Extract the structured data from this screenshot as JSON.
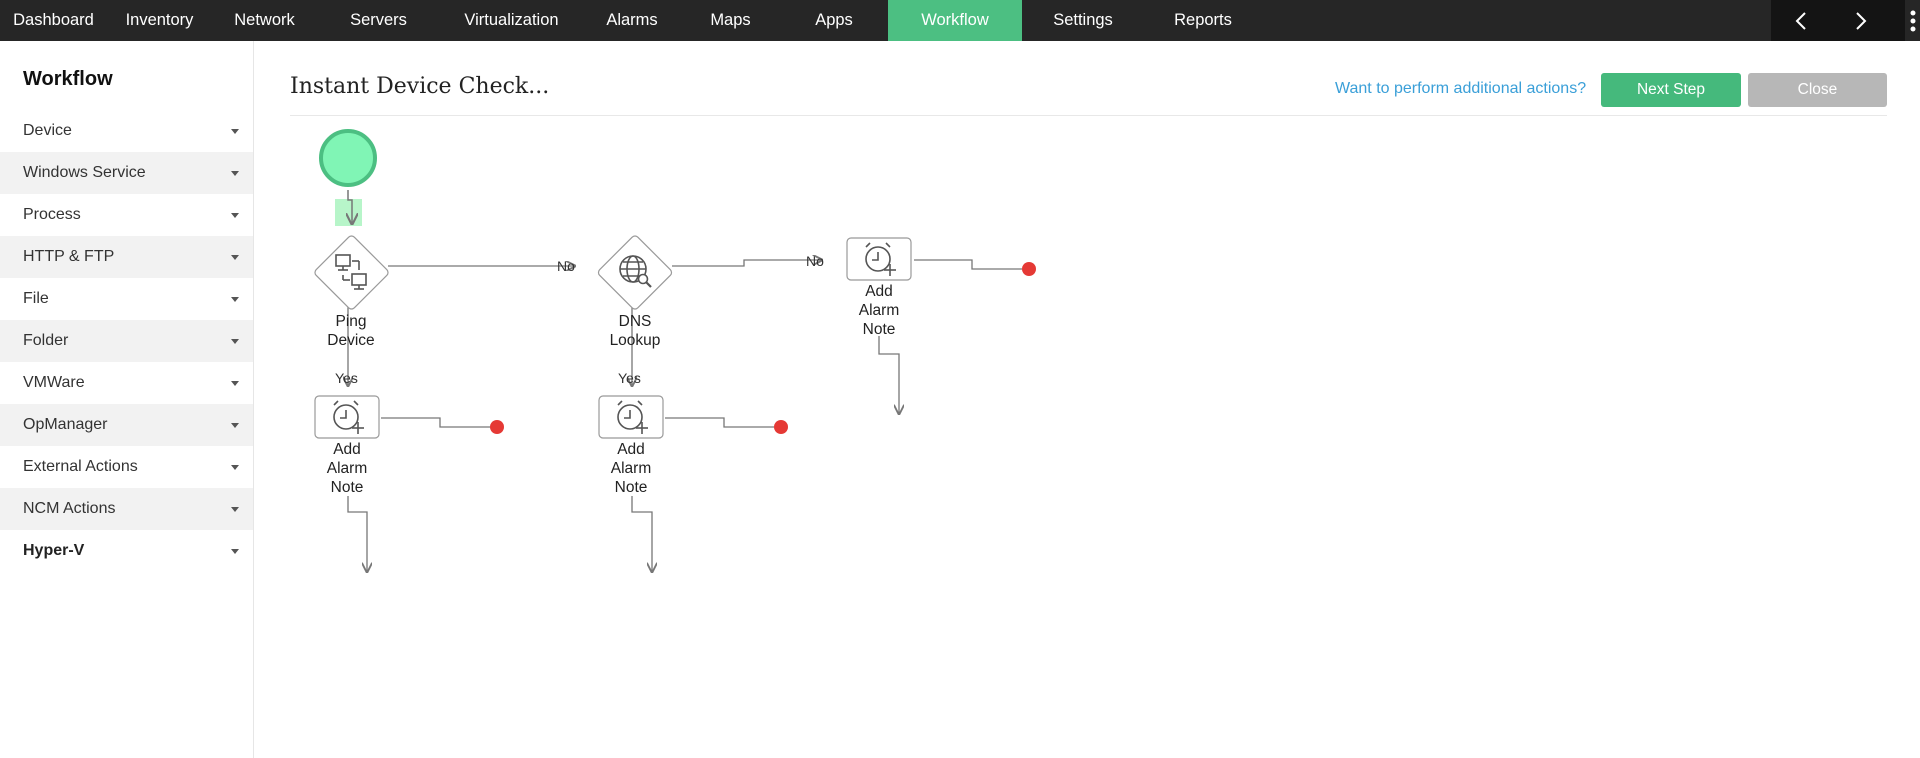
{
  "nav": {
    "items": [
      {
        "label": "Dashboard",
        "width": 107
      },
      {
        "label": "Inventory",
        "width": 105
      },
      {
        "label": "Network",
        "width": 105
      },
      {
        "label": "Servers",
        "width": 123
      },
      {
        "label": "Virtualization",
        "width": 143
      },
      {
        "label": "Alarms",
        "width": 98
      },
      {
        "label": "Maps",
        "width": 99
      },
      {
        "label": "Apps",
        "width": 108
      },
      {
        "label": "Workflow",
        "width": 134,
        "active": true
      },
      {
        "label": "Settings",
        "width": 122
      },
      {
        "label": "Reports",
        "width": 118
      }
    ]
  },
  "sidebar": {
    "title": "Workflow",
    "items": [
      {
        "label": "Device"
      },
      {
        "label": "Windows Service"
      },
      {
        "label": "Process"
      },
      {
        "label": "HTTP & FTP"
      },
      {
        "label": "File"
      },
      {
        "label": "Folder"
      },
      {
        "label": "VMWare"
      },
      {
        "label": "OpManager"
      },
      {
        "label": "External Actions"
      },
      {
        "label": "NCM Actions"
      },
      {
        "label": "Hyper-V",
        "bold": true
      }
    ]
  },
  "header": {
    "title": "Instant Device Check...",
    "link": "Want to perform additional actions?",
    "next_label": "Next Step",
    "close_label": "Close"
  },
  "workflow": {
    "nodes": {
      "ping": {
        "line1": "Ping",
        "line2": "Device"
      },
      "dns": {
        "line1": "DNS",
        "line2": "Lookup"
      },
      "note_top": {
        "line1": "Add",
        "line2": "Alarm",
        "line3": "Note"
      },
      "note_left": {
        "line1": "Add",
        "line2": "Alarm",
        "line3": "Note"
      },
      "note_mid": {
        "line1": "Add",
        "line2": "Alarm",
        "line3": "Note"
      }
    },
    "edges": {
      "ping_no": "No",
      "dns_no": "No",
      "ping_yes": "Yes",
      "dns_yes": "Yes"
    }
  },
  "colors": {
    "accent": "#4cbf82",
    "start_node": "#80f5b5",
    "end_node": "#e53935",
    "link": "#3a9fd8"
  }
}
